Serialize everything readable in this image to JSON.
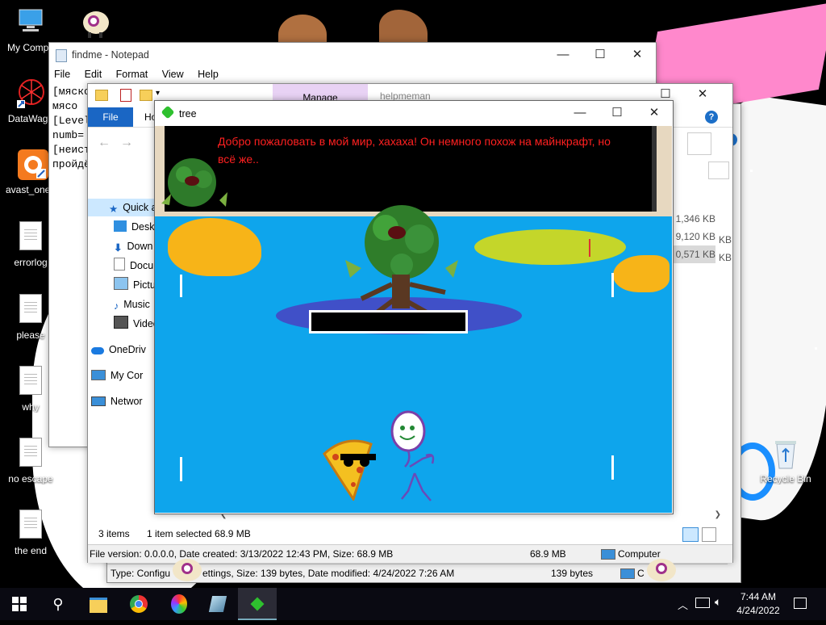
{
  "desktop": {
    "icons": [
      {
        "label": "My Compu",
        "icon": "computer-icon"
      },
      {
        "label": "",
        "icon": "sheep-icon"
      },
      {
        "label": "DataWago",
        "icon": "datawagon-icon"
      },
      {
        "label": "avast_one_",
        "icon": "avast-icon"
      },
      {
        "label": "errorlog",
        "icon": "file-icon"
      },
      {
        "label": "please",
        "icon": "file-icon"
      },
      {
        "label": "why",
        "icon": "file-icon"
      },
      {
        "label": "no escape",
        "icon": "file-icon"
      },
      {
        "label": "the end",
        "icon": "file-icon"
      },
      {
        "label": "Recycle Bin",
        "icon": "recycle-bin-icon"
      }
    ]
  },
  "notepad": {
    "title": "findme - Notepad",
    "menu": [
      "File",
      "Edit",
      "Format",
      "View",
      "Help"
    ],
    "lines": [
      "[мяско",
      "мясо",
      "[Level",
      "numb=",
      "[неист",
      "пройдё"
    ]
  },
  "explorer": {
    "ribbon_tab_file": "File",
    "ribbon_tab_home": "Ho",
    "manage_tab": "Manage",
    "title_partial": "helpmeman",
    "nav": [
      {
        "label": "Quick a",
        "icon": "star-icon"
      },
      {
        "label": "Deskt",
        "icon": "desktop-folder-icon"
      },
      {
        "label": "Down",
        "icon": "download-icon"
      },
      {
        "label": "Docu",
        "icon": "documents-icon"
      },
      {
        "label": "Pictur",
        "icon": "pictures-icon"
      },
      {
        "label": "Music",
        "icon": "music-icon"
      },
      {
        "label": "Video",
        "icon": "video-icon"
      },
      {
        "label": "OneDriv",
        "icon": "onedrive-icon"
      },
      {
        "label": "My Cor",
        "icon": "computer-icon"
      },
      {
        "label": "Networ",
        "icon": "network-icon"
      }
    ],
    "sizes": [
      "1,346 KB",
      "9,120 KB",
      "0,571 KB"
    ],
    "sizes_back": [
      "KB",
      "KB"
    ],
    "status_items": "3 items",
    "status_selected": "1 item selected  68.9 MB",
    "details_bar": "File version: 0.0.0.0, Date created: 3/13/2022 12:43 PM, Size: 68.9 MB",
    "details_size": "68.9 MB",
    "details_location": "Computer"
  },
  "back_window": {
    "details_bar": "Type: Configuration Settings, Size: 139 bytes, Date modified: 4/24/2022 7:26 AM",
    "details_bar_left": "Type: Configu",
    "details_bar_right": "ettings, Size: 139 bytes, Date modified: 4/24/2022 7:26 AM",
    "size": "139 bytes",
    "location": "C"
  },
  "game": {
    "title": "tree",
    "dialog": "Добро пожаловать в мой мир, хахаха! Он немного похож на майнкрафт, но всё же.."
  },
  "taskbar": {
    "time": "7:44 AM",
    "date": "4/24/2022",
    "pinned": [
      "start-icon",
      "search-icon",
      "file-explorer-icon",
      "chrome-icon",
      "paint-icon",
      "app-icon",
      "tree-game-icon"
    ]
  },
  "colors": {
    "game_sky": "#0ea5ec",
    "dialog_text": "#ff2020",
    "manage_tab": "#e8d2f4",
    "selection": "#cce8ff"
  }
}
